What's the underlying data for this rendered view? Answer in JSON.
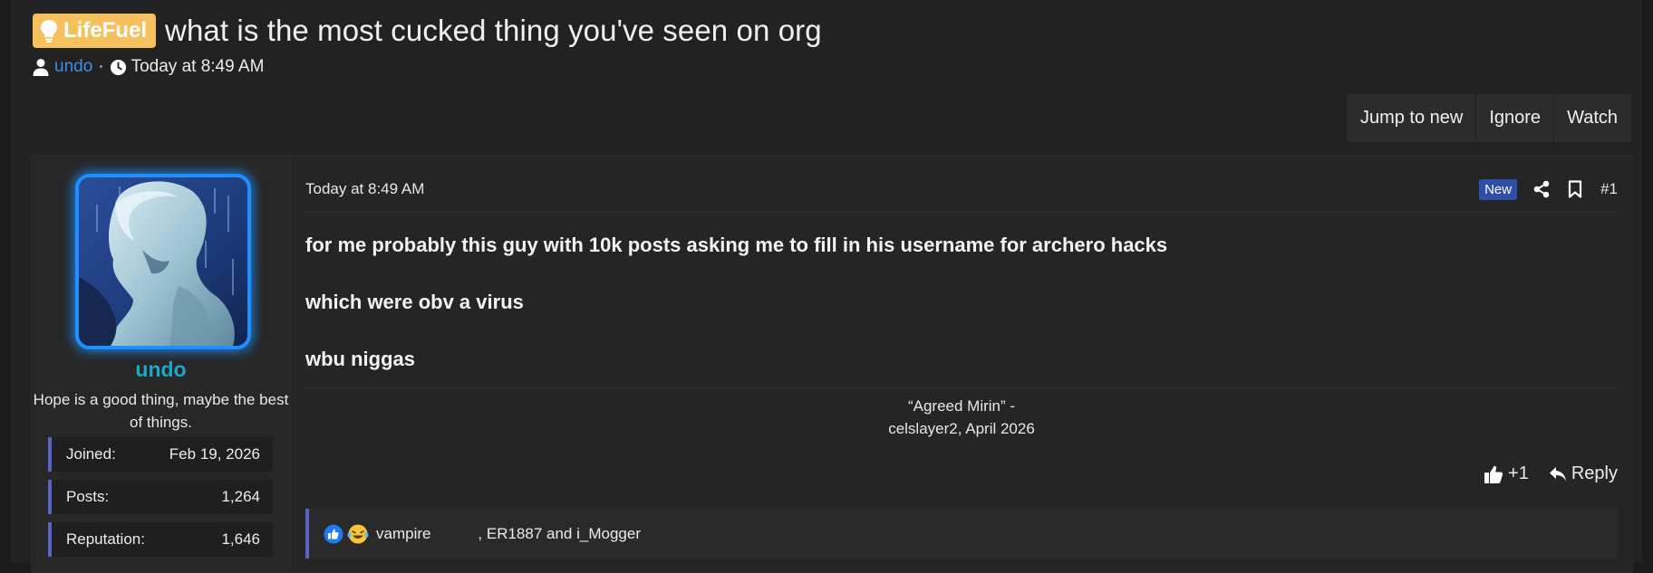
{
  "thread": {
    "prefix": "LifeFuel",
    "title": "what is the most cucked thing you've seen on org",
    "author": "undo",
    "separator": "·",
    "date": "Today at 8:49 AM"
  },
  "actions_bar": {
    "jump_to_new": "Jump to new",
    "ignore": "Ignore",
    "watch": "Watch"
  },
  "post": {
    "user": {
      "username": "undo",
      "user_title": "Hope is a good thing, maybe the best of things.",
      "stats": [
        {
          "label": "Joined:",
          "value": "Feb 19, 2026"
        },
        {
          "label": "Posts:",
          "value": "1,264"
        },
        {
          "label": "Reputation:",
          "value": "1,646"
        }
      ]
    },
    "date": "Today at 8:49 AM",
    "badge_new": "New",
    "post_number": "#1",
    "body": [
      "for me probably this guy with 10k posts asking me to fill in his username for archero hacks",
      "which were obv a virus",
      "wbu niggas"
    ],
    "signature_line1": "“Agreed Mirin” -",
    "signature_line2": "celslayer2, April 2026",
    "reaction_count": "+1",
    "reply_label": "Reply",
    "reactions_text": "vampire           , ER1887 and i_Mogger"
  },
  "colors": {
    "background": "#1b1b1b",
    "panel": "#222222",
    "prefix": "#f6c15d",
    "link": "#3b8fe6",
    "username": "#1ea7c9",
    "stat_accent": "#5865c8",
    "new_badge": "#2f4ea8"
  },
  "icons": [
    "lightbulb-icon",
    "user-icon",
    "clock-icon",
    "share-icon",
    "bookmark-icon",
    "thumbs-up-icon",
    "reply-icon",
    "like-emoji-icon",
    "laugh-emoji-icon"
  ]
}
